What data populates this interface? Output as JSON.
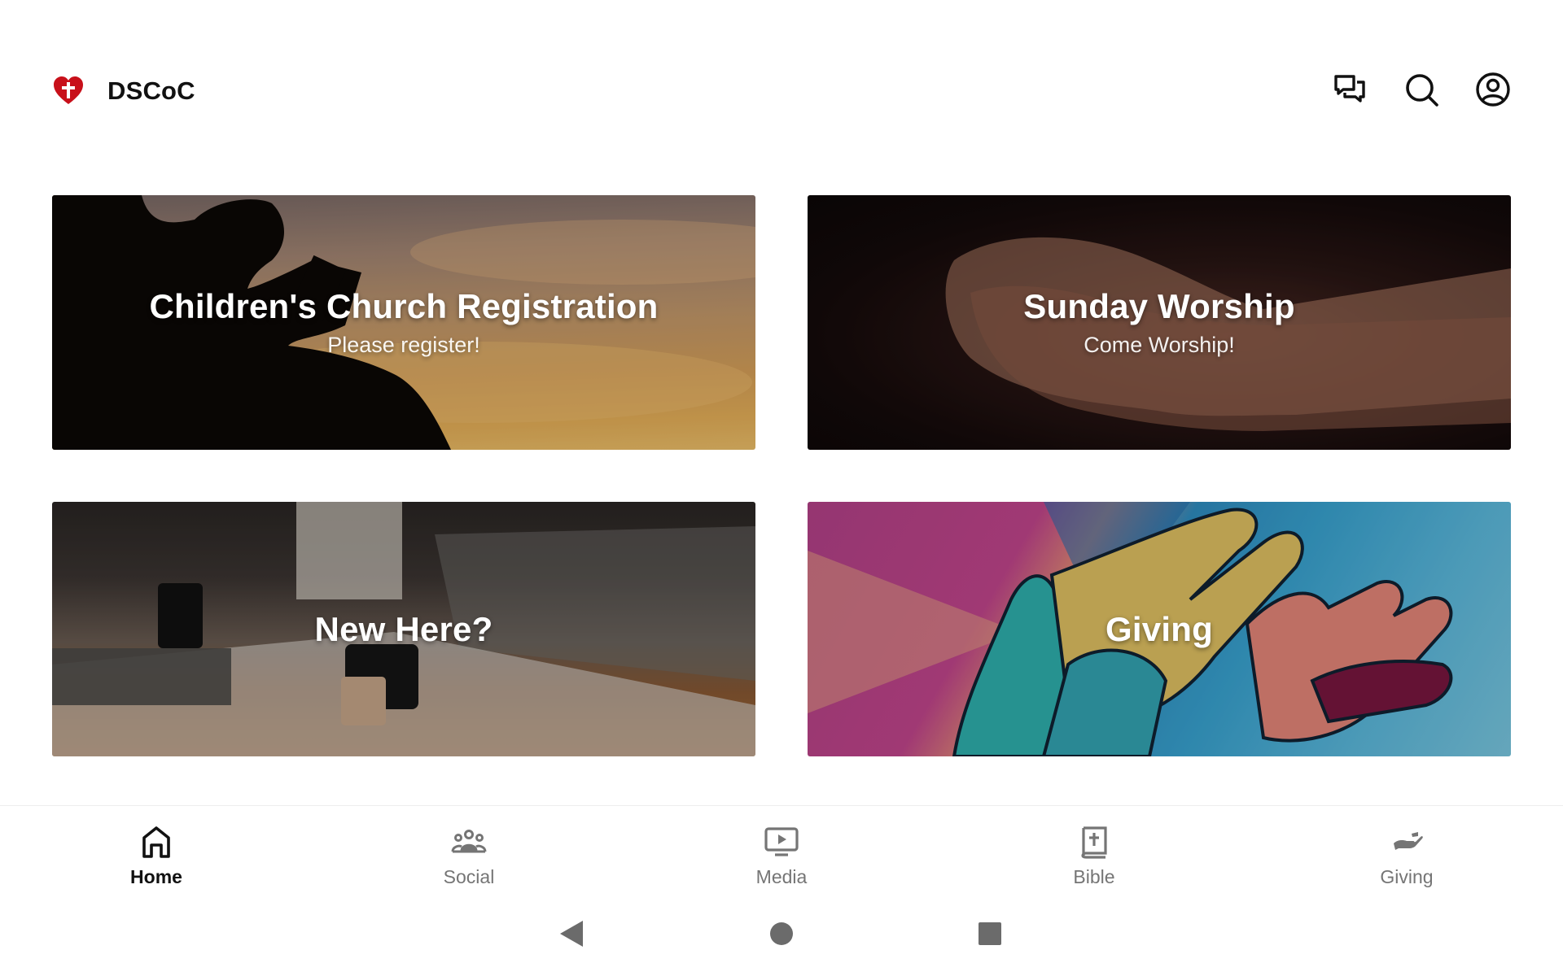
{
  "app": {
    "name": "DSCoC",
    "logo_color": "#c8101a"
  },
  "header": {
    "actions": [
      {
        "icon": "chat-icon"
      },
      {
        "icon": "search-icon"
      },
      {
        "icon": "account-icon"
      }
    ]
  },
  "cards": [
    {
      "title": "Children's Church Registration",
      "subtitle": "Please register!",
      "image": "sunset-reading-silhouette"
    },
    {
      "title": "Sunday Worship",
      "subtitle": "Come Worship!",
      "image": "open-hands-dark"
    },
    {
      "title": "New Here?",
      "subtitle": "",
      "image": "living-room-camera"
    },
    {
      "title": "Giving",
      "subtitle": "",
      "image": "colorful-hands-mural"
    }
  ],
  "bottom_nav": {
    "active_color": "#111111",
    "inactive_color": "#757575",
    "items": [
      {
        "label": "Home",
        "icon": "home-icon",
        "active": true
      },
      {
        "label": "Social",
        "icon": "group-icon",
        "active": false
      },
      {
        "label": "Media",
        "icon": "video-icon",
        "active": false
      },
      {
        "label": "Bible",
        "icon": "bible-icon",
        "active": false
      },
      {
        "label": "Giving",
        "icon": "giving-hand-icon",
        "active": false
      }
    ]
  },
  "system_nav": {
    "buttons": [
      {
        "icon": "back-triangle-icon"
      },
      {
        "icon": "home-circle-icon"
      },
      {
        "icon": "recents-square-icon"
      }
    ]
  }
}
